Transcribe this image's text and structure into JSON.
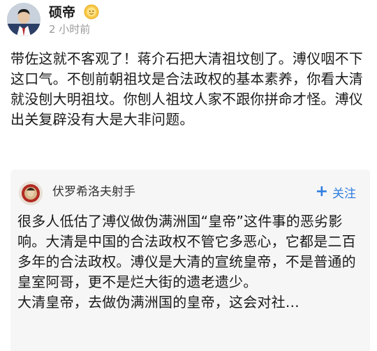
{
  "post": {
    "author_name": "硕帝",
    "time": "2 小时前",
    "text": "带佐这就不客观了！蒋介石把大清祖坟刨了。溥仪咽不下这口气。不刨前朝祖坟是合法政权的基本素养，你看大清就没刨大明祖坟。你刨人祖坟人家不跟你拼命才怪。溥仪出关复辟没有大是大非问题。"
  },
  "quote": {
    "author_name": "伏罗希洛夫射手",
    "follow_label": "关注",
    "text_para1": "很多人低估了溥仪做伪满洲国“皇帝”这件事的恶劣影响。大清是中国的合法政权不管它多恶心，它都是二百多年的合法政权。溥仪是大清的宣统皇帝，不是普通的皇室阿哥，更不是烂大街的遗老遗少。",
    "text_para2": "大清皇帝，去做伪满洲国的皇帝，这会对社…"
  },
  "colors": {
    "accent": "#2f7de0",
    "muted": "#9a9a9a",
    "card_bg": "#f6f6f6"
  },
  "icons": {
    "author_avatar": "person-avatar",
    "badge": "gold-badge-icon",
    "quote_avatar": "person-avatar",
    "follow": "plus-icon"
  }
}
